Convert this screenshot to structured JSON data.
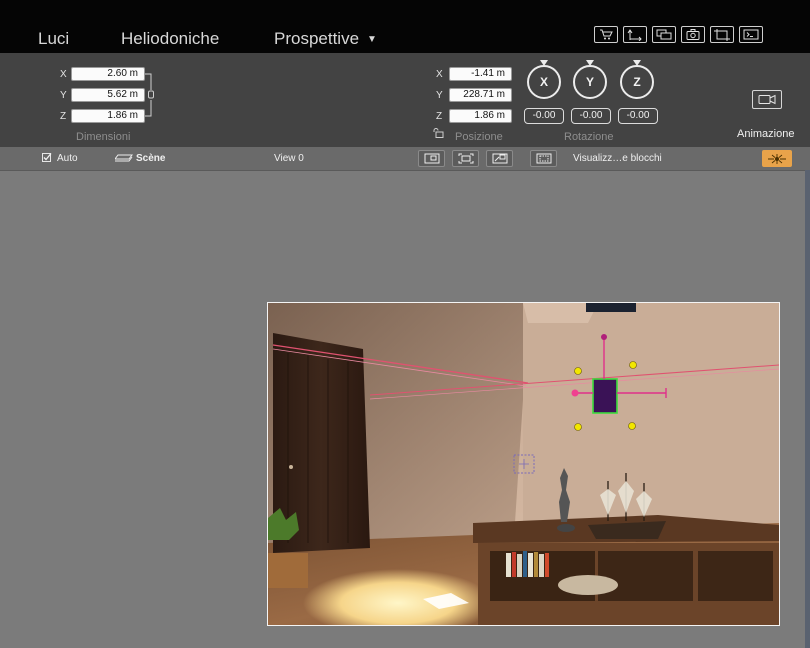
{
  "tabs": [
    {
      "label": "Luci"
    },
    {
      "label": "Heliodoniche"
    },
    {
      "label": "Prospettive",
      "dropdown": true
    }
  ],
  "toolbar_icons": [
    "cart-icon",
    "export-arrow-icon",
    "windows-icon",
    "camera-icon",
    "crop-icon",
    "terminal-icon"
  ],
  "dimensions": {
    "caption": "Dimensioni",
    "x_label": "X",
    "x_value": "2.60 m",
    "y_label": "Y",
    "y_value": "5.62 m",
    "z_label": "Z",
    "z_value": "1.86 m"
  },
  "position": {
    "caption": "Posizione",
    "x_label": "X",
    "x_value": "-1.41 m",
    "y_label": "Y",
    "y_value": "228.71 m",
    "z_label": "Z",
    "z_value": "1.86 m"
  },
  "rotation": {
    "caption": "Rotazione",
    "knobs": [
      {
        "label": "X",
        "value": "-0.00"
      },
      {
        "label": "Y",
        "value": "-0.00"
      },
      {
        "label": "Z",
        "value": "-0.00"
      }
    ]
  },
  "animation": {
    "label": "Animazione"
  },
  "subbar": {
    "auto_label": "Auto",
    "auto_checked": true,
    "scene_label": "Scène",
    "view_label": "View 0",
    "blocks_label": "Visualizz…e blocchi"
  },
  "colors": {
    "accent_sun": "#e8a34a",
    "selection_green": "#3ddc3d",
    "gizmo_magenta": "#e0308a",
    "handle_yellow": "#f2e600"
  }
}
